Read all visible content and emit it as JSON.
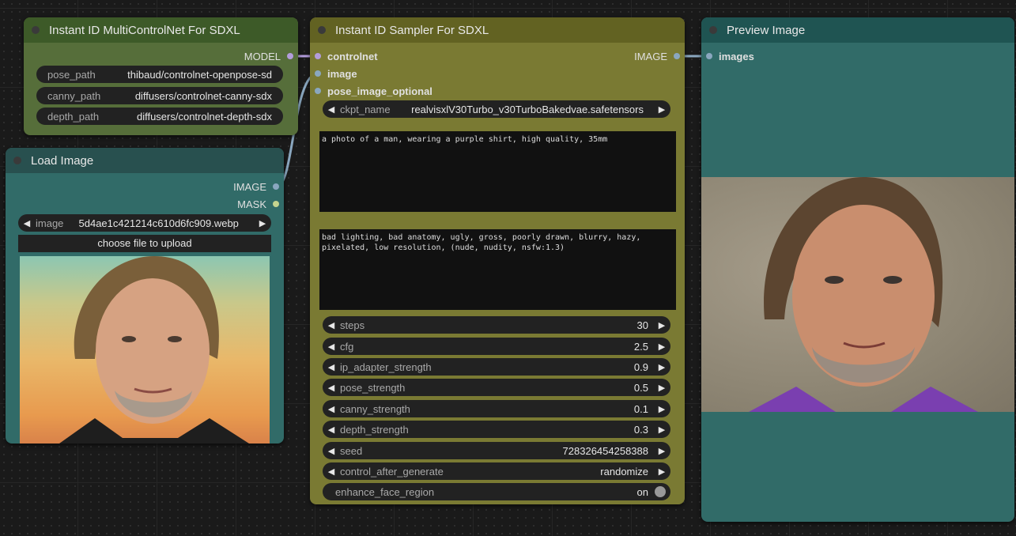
{
  "colors": {
    "canvas_bg": "#1a1a1a",
    "multicontrolnet_header": "#3d5a28",
    "multicontrolnet_body": "#566e3a",
    "load_image_header": "#28504f",
    "load_image_body": "#316b68",
    "sampler_header": "#626222",
    "sampler_body": "#7a7a33",
    "preview_header": "#1f5452",
    "preview_body": "#316b68",
    "model_link": "#b39ddb",
    "image_link": "#8aa7bf",
    "mask_dot": "#c5d48f"
  },
  "multicontrolnet": {
    "title": "Instant ID MultiControlNet For SDXL",
    "output_model": "MODEL",
    "widgets": [
      {
        "name": "pose_path",
        "value": "thibaud/controlnet-openpose-sd"
      },
      {
        "name": "canny_path",
        "value": "diffusers/controlnet-canny-sdx"
      },
      {
        "name": "depth_path",
        "value": "diffusers/controlnet-depth-sdx"
      }
    ]
  },
  "load_image": {
    "title": "Load Image",
    "output_image": "IMAGE",
    "output_mask": "MASK",
    "image_widget_name": "image",
    "image_widget_value": "5d4ae1c421214c610d6fc909.webp",
    "upload_label": "choose file to upload",
    "preview_icon": "portrait-photo"
  },
  "sampler": {
    "title": "Instant ID Sampler For SDXL",
    "inputs": [
      "controlnet",
      "image",
      "pose_image_optional"
    ],
    "output_image": "IMAGE",
    "ckpt_name_label": "ckpt_name",
    "ckpt_name_value": "realvisxlV30Turbo_v30TurboBakedvae.safetensors",
    "positive_prompt": "a photo of a man, wearing a purple shirt, high quality, 35mm",
    "negative_prompt": "bad lighting, bad anatomy, ugly, gross, poorly drawn, blurry, hazy, pixelated, low resolution, (nude, nudity, nsfw:1.3)",
    "params": [
      {
        "name": "steps",
        "value": "30"
      },
      {
        "name": "cfg",
        "value": "2.5"
      },
      {
        "name": "ip_adapter_strength",
        "value": "0.9"
      },
      {
        "name": "pose_strength",
        "value": "0.5"
      },
      {
        "name": "canny_strength",
        "value": "0.1"
      },
      {
        "name": "depth_strength",
        "value": "0.3"
      },
      {
        "name": "seed",
        "value": "728326454258388"
      },
      {
        "name": "control_after_generate",
        "value": "randomize"
      }
    ],
    "toggle_name": "enhance_face_region",
    "toggle_value": "on"
  },
  "preview": {
    "title": "Preview Image",
    "input_images": "images",
    "preview_icon": "portrait-photo"
  }
}
